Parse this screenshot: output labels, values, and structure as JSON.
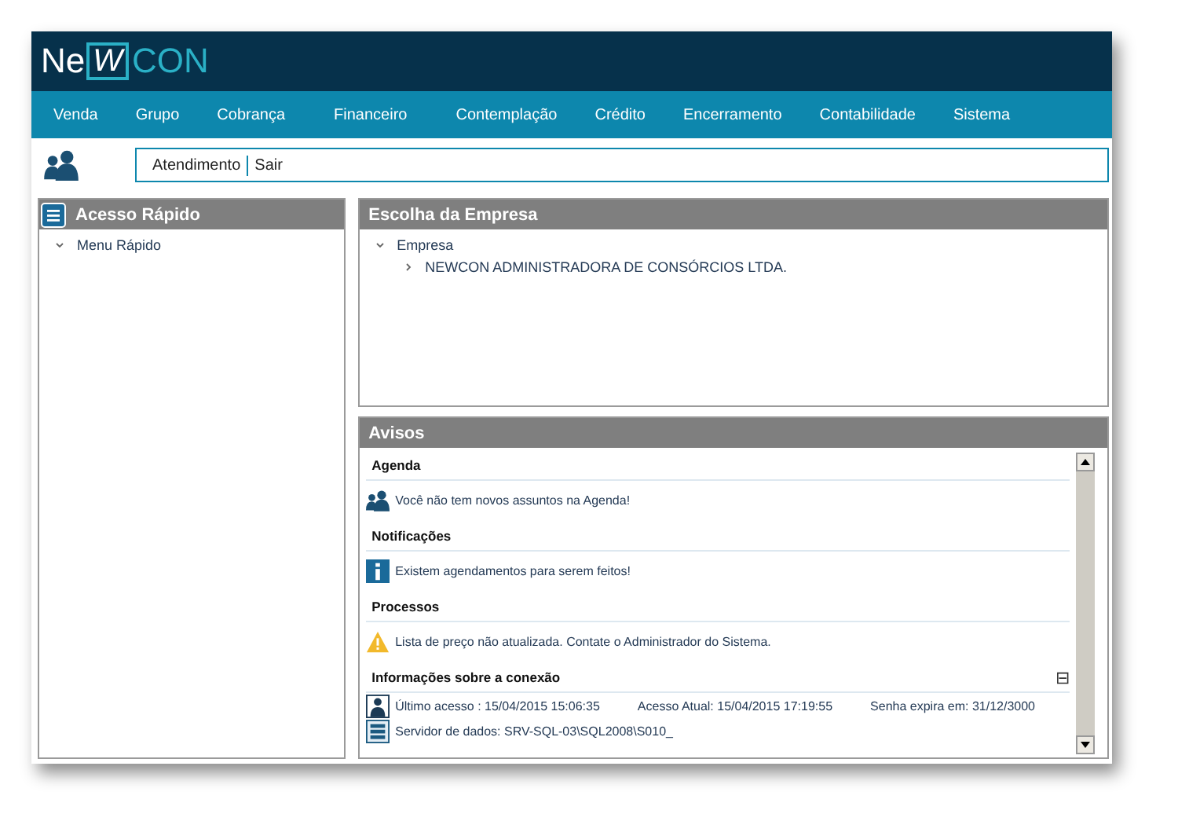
{
  "logo": {
    "part_1": "Ne",
    "part_2": "W",
    "part_3": "CON"
  },
  "menu": [
    "Venda",
    "Grupo",
    "Cobrança",
    "Financeiro",
    "Contemplação",
    "Crédito",
    "Encerramento",
    "Contabilidade",
    "Sistema"
  ],
  "toolbar": {
    "links": [
      "Atendimento",
      "Sair"
    ]
  },
  "quick_access": {
    "title": "Acesso Rápido",
    "items": [
      {
        "label": "Menu Rápido",
        "expanded": true
      }
    ]
  },
  "company": {
    "title": "Escolha da Empresa",
    "tree": [
      {
        "label": "Empresa",
        "expanded": true,
        "children": [
          {
            "label": "NEWCON ADMINISTRADORA DE CONSÓRCIOS LTDA.",
            "expanded": false
          }
        ]
      }
    ]
  },
  "notices": {
    "title": "Avisos",
    "sections": [
      {
        "heading": "Agenda",
        "items": [
          {
            "kind": "people",
            "texts": [
              "Você não tem novos assuntos na Agenda!"
            ]
          }
        ]
      },
      {
        "heading": "Notificações",
        "items": [
          {
            "kind": "info",
            "texts": [
              "Existem agendamentos para serem feitos!"
            ]
          }
        ]
      },
      {
        "heading": "Processos",
        "items": [
          {
            "kind": "warning",
            "texts": [
              "Lista de preço não atualizada. Contate o Administrador do Sistema."
            ]
          }
        ]
      },
      {
        "heading": "Informações sobre a conexão",
        "collapse": "⊟",
        "items": [
          {
            "kind": "user",
            "texts": [
              "Último acesso : 15/04/2015 15:06:35",
              "Acesso Atual: 15/04/2015 17:19:55",
              "Senha expira em: 31/12/3000"
            ]
          },
          {
            "kind": "server",
            "texts": [
              "Servidor de dados: SRV-SQL-03\\SQL2008\\S010_"
            ]
          }
        ]
      }
    ]
  }
}
